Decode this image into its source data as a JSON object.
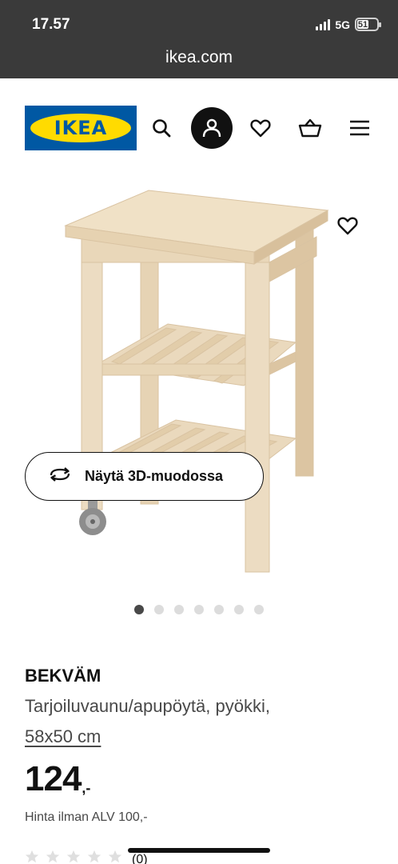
{
  "status_bar": {
    "time": "17.57",
    "network": "5G",
    "battery": "51"
  },
  "browser": {
    "url": "ikea.com"
  },
  "header": {
    "logo_text": "IKEA",
    "icons": [
      "search-icon",
      "account-icon",
      "heart-icon",
      "shopping-bag-icon",
      "menu-icon"
    ]
  },
  "gallery": {
    "view_3d_label": "Näytä 3D-muodossa",
    "image_count": 7,
    "active_index": 0
  },
  "product": {
    "name": "BEKVÄM",
    "description": "Tarjoiluvaunu/apupöytä, pyökki,",
    "size": "58x50 cm",
    "price_integer": "124",
    "price_decimal": ",-",
    "vat_note": "Hinta ilman ALV 100,-",
    "rating_count": "(0)"
  },
  "colors": {
    "status_bar_bg": "#3a3a3a",
    "ikea_blue": "#0058a3",
    "ikea_yellow": "#ffdb00",
    "text_primary": "#111111",
    "text_secondary": "#484848"
  }
}
